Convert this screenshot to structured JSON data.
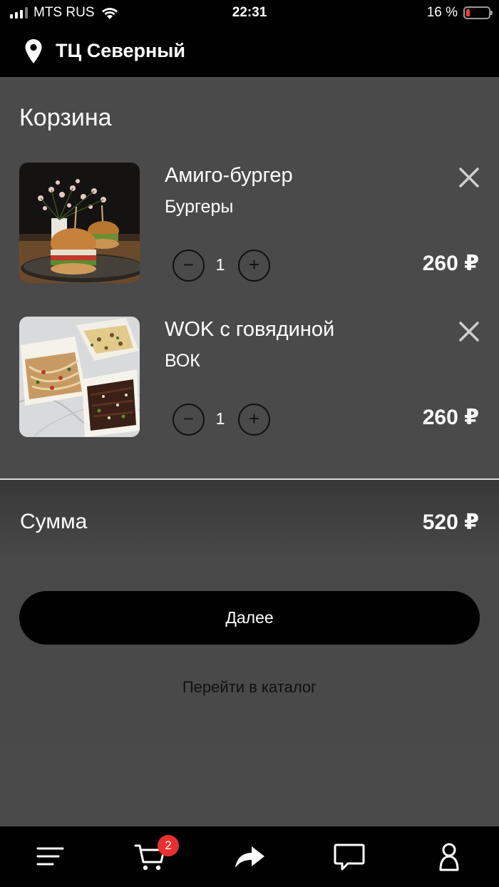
{
  "status_bar": {
    "carrier": "MTS RUS",
    "time": "22:31",
    "battery_percent": "16 %",
    "battery_level": 0.16,
    "signal_bars": 4,
    "signal_bars_filled": 3
  },
  "header": {
    "location_icon": "map-pin-icon",
    "store_name": "ТЦ Северный"
  },
  "page": {
    "title": "Корзина"
  },
  "cart": {
    "items": [
      {
        "name": "Амиго-бургер",
        "category": "Бургеры",
        "quantity": "1",
        "price": "260 ₽",
        "image": "burger-photo",
        "minus_label": "−",
        "plus_label": "+"
      },
      {
        "name": "WOK с говядиной",
        "category": "ВОК",
        "quantity": "1",
        "price": "260 ₽",
        "image": "wok-photo",
        "minus_label": "−",
        "plus_label": "+"
      }
    ]
  },
  "summary": {
    "label": "Сумма",
    "value": "520 ₽"
  },
  "actions": {
    "next_label": "Далее",
    "catalog_label": "Перейти в каталог"
  },
  "tab_bar": {
    "items": [
      "menu-icon",
      "cart-icon",
      "share-icon",
      "chat-icon",
      "profile-icon"
    ],
    "cart_badge": "2"
  },
  "colors": {
    "background": "#4a4a4a",
    "bars": "#000000",
    "badge": "#e8312f",
    "battery_low": "#ff3b30"
  }
}
